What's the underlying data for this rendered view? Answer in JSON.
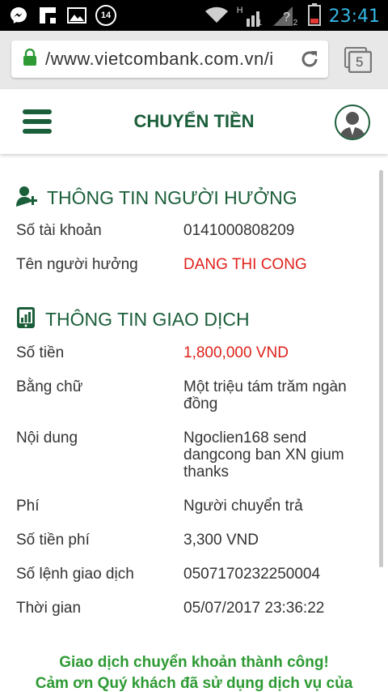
{
  "status_bar": {
    "notification_badge": "14",
    "signal_label": "H",
    "sim1": "1",
    "sim2": "2",
    "time": "23:41"
  },
  "browser": {
    "url": "/www.vietcombank.com.vn/i",
    "tab_count": "5"
  },
  "header": {
    "title": "CHUYỂN TIỀN"
  },
  "beneficiary": {
    "section_title": "THÔNG TIN NGƯỜI HƯỞNG",
    "account_label": "Số tài khoản",
    "account_value": "0141000808209",
    "name_label": "Tên người hưởng",
    "name_value": "DANG THI CONG"
  },
  "transaction": {
    "section_title": "THÔNG TIN GIAO DỊCH",
    "amount_label": "Số tiền",
    "amount_value": "1,800,000 VND",
    "words_label": "Bằng chữ",
    "words_value_line1": "Một triệu tám trăm ngàn",
    "words_value_line2": "đồng",
    "content_label": "Nội dung",
    "content_value_line1": "Ngoclien168 send",
    "content_value_line2": "dangcong ban XN gium",
    "content_value_line3": "thanks",
    "fee_label": "Phí",
    "fee_value": "Người chuyển trả",
    "fee_amount_label": "Số tiền phí",
    "fee_amount_value": "3,300 VND",
    "order_label": "Số lệnh giao dịch",
    "order_value": "0507170232250004",
    "time_label": "Thời gian",
    "time_value": "05/07/2017 23:36:22"
  },
  "message": {
    "line1": "Giao dịch chuyển khoản thành công!",
    "line2": "Cảm ơn Quý khách đã sử dụng dịch vụ của"
  },
  "colors": {
    "brand_green": "#1b5e3a",
    "highlight_red": "#e0211b",
    "success_green": "#2e9a34",
    "clock_blue": "#35b8e6"
  },
  "icons": [
    "messenger-icon",
    "flipboard-icon",
    "gallery-icon",
    "notification-badge",
    "wifi-icon",
    "signal-icon",
    "battery-icon",
    "lock-icon",
    "reload-icon",
    "tabs-icon",
    "menu-icon",
    "avatar-icon",
    "add-user-icon",
    "phone-chart-icon"
  ]
}
